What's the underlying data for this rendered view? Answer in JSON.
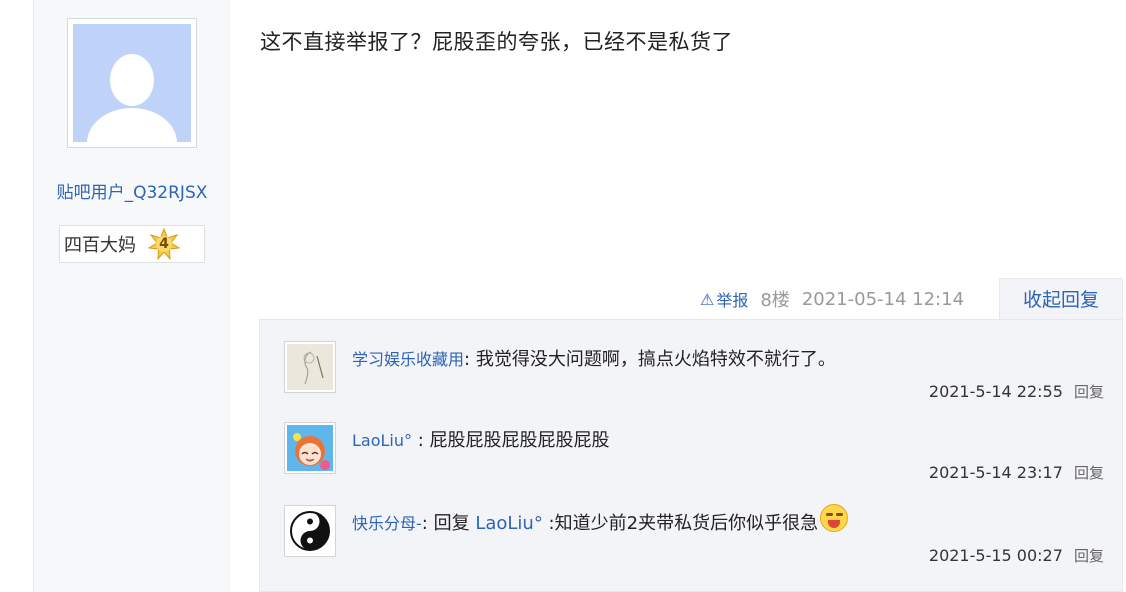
{
  "author": {
    "name": "贴吧用户_Q32RJSX",
    "level_name": "四百大妈",
    "level_num": "4"
  },
  "post": {
    "content": "这不直接举报了？屁股歪的夸张，已经不是私货了",
    "report_label": "举报",
    "floor": "8楼",
    "time": "2021-05-14 12:14",
    "collapse_label": "收起回复"
  },
  "replies": [
    {
      "user": "学习娱乐收藏用",
      "sep": ":",
      "text": " 我觉得没大问题啊，搞点火焰特效不就行了。",
      "time": "2021-5-14 22:55",
      "reply_label": "回复"
    },
    {
      "user": "LaoLiu°",
      "sep": " :",
      "text": " 屁股屁股屁股屁股屁股",
      "time": "2021-5-14 23:17",
      "reply_label": "回复"
    },
    {
      "user": "快乐分母-",
      "sep": ":",
      "prefix": " 回复 ",
      "mention": "LaoLiu°",
      "text": " :知道少前2夹带私货后你似乎很急",
      "time": "2021-5-15 00:27",
      "reply_label": "回复"
    }
  ],
  "colors": {
    "link": "#2d64b3",
    "meta": "#999999",
    "reply_bg": "#f3f4f7"
  }
}
